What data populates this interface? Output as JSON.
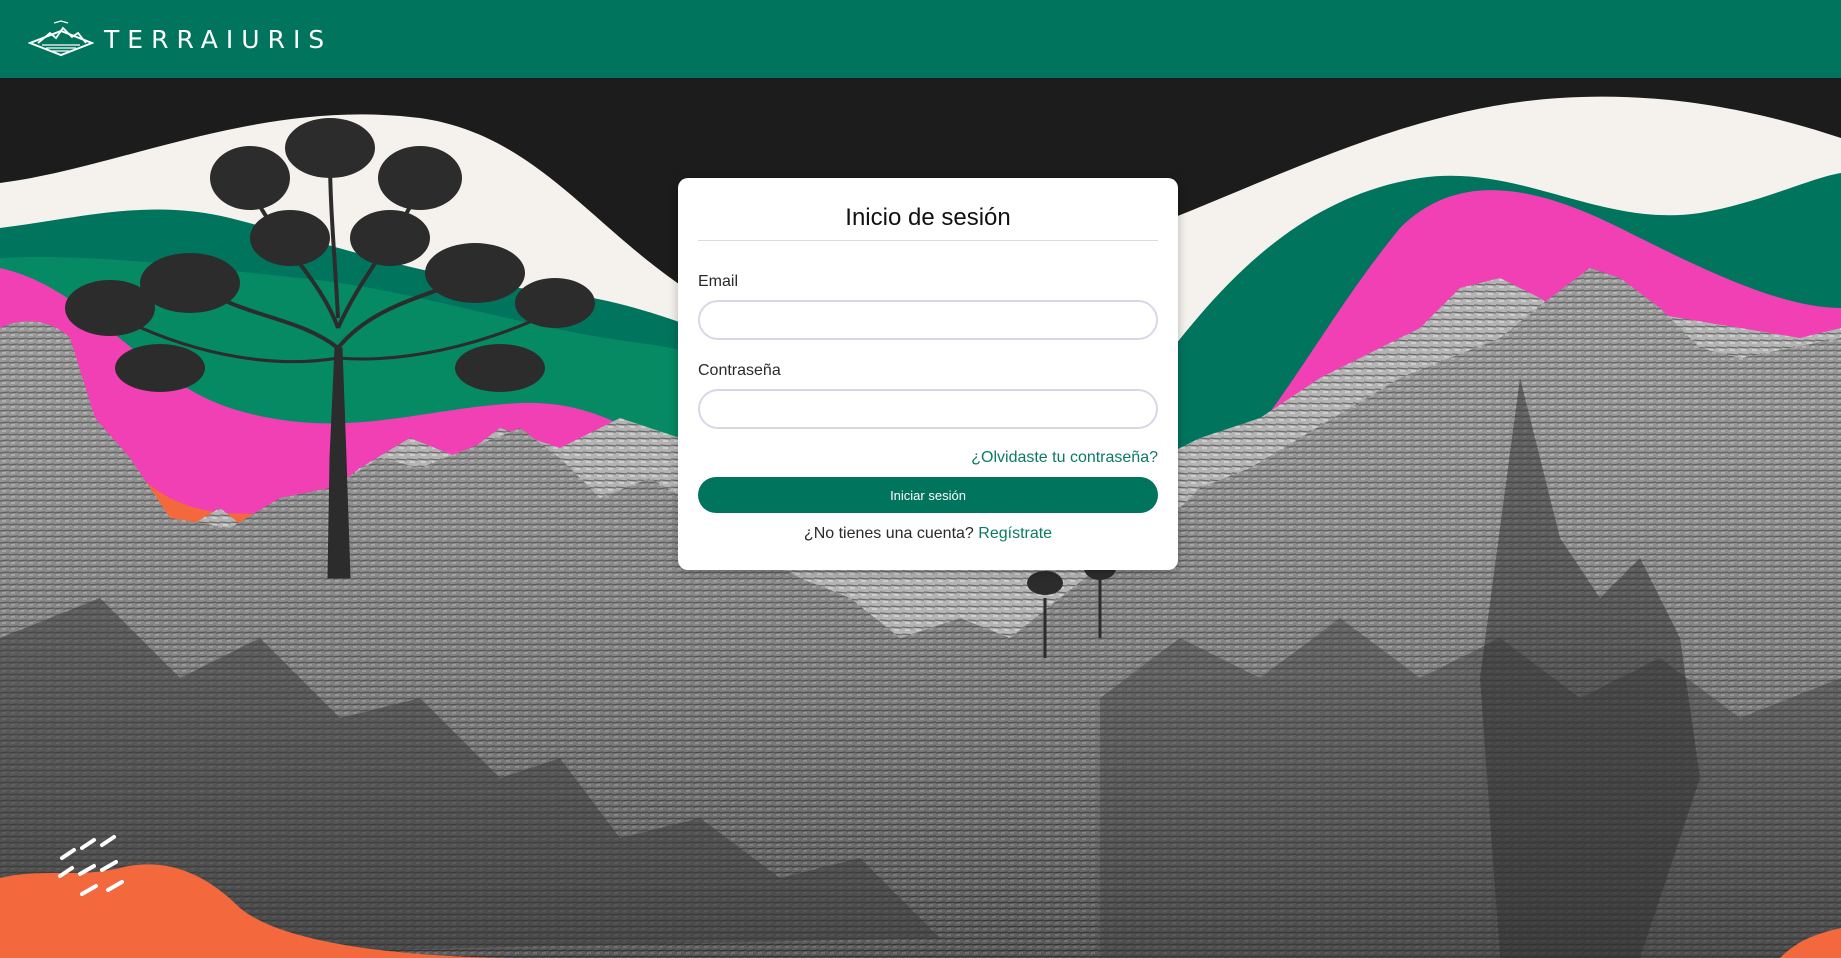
{
  "brand": {
    "name": "TERRAIURIS",
    "color": "#00745d"
  },
  "login": {
    "title": "Inicio de sesión",
    "email_label": "Email",
    "email_value": "",
    "password_label": "Contraseña",
    "password_value": "",
    "forgot_link": "¿Olvidaste tu contraseña?",
    "submit_label": "Iniciar sesión",
    "no_account_text": "¿No tienes una cuenta?",
    "register_link": "Regístrate"
  },
  "background": {
    "palette": {
      "green": "#00745d",
      "green_light": "#058a64",
      "pink": "#f040b4",
      "orange": "#f4683e",
      "cream": "#f5f2ee",
      "dark": "#1b1c1b"
    }
  }
}
